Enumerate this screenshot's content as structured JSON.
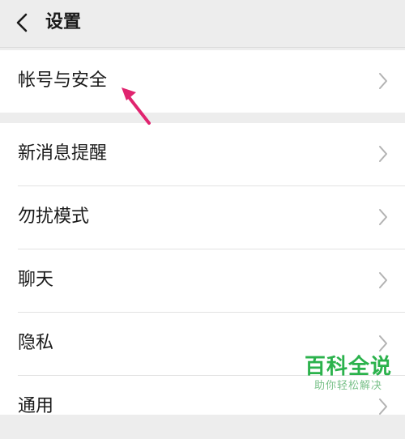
{
  "header": {
    "title": "设置",
    "back_icon": "chevron-left-icon"
  },
  "account": {
    "label": "帐号与安全"
  },
  "menu": {
    "items": [
      {
        "label": "新消息提醒"
      },
      {
        "label": "勿扰模式"
      },
      {
        "label": "聊天"
      },
      {
        "label": "隐私"
      },
      {
        "label": "通用"
      }
    ]
  },
  "annotation": {
    "icon": "arrow-pointer-icon",
    "color": "#e0246f"
  },
  "watermark": {
    "title": "百科全说",
    "subtitle": "助你轻松解决",
    "color": "#2bb24c"
  },
  "colors": {
    "background": "#ededed",
    "surface": "#ffffff",
    "text": "#1a1a1a",
    "chevron": "#b2b2b2"
  }
}
